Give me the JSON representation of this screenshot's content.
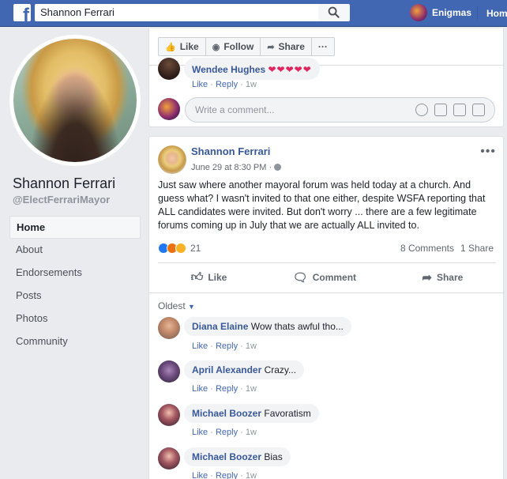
{
  "topbar": {
    "search_value": "Shannon Ferrari",
    "user_name": "Enigmas",
    "home_label": "Hom"
  },
  "profile": {
    "name": "Shannon Ferrari",
    "handle": "@ElectFerrariMayor",
    "nav": [
      "Home",
      "About",
      "Endorsements",
      "Posts",
      "Photos",
      "Community"
    ],
    "active": "Home"
  },
  "action_bar": {
    "like": "Like",
    "follow": "Follow",
    "share": "Share",
    "more": "···"
  },
  "prev_post": {
    "reply_author": "Wendee Hughes",
    "reply_text": "❤❤❤❤❤",
    "reply_like": "Like",
    "reply_reply": "Reply",
    "reply_time": "1w",
    "comment_placeholder": "Write a comment..."
  },
  "post": {
    "author": "Shannon Ferrari",
    "time": "June 29 at 8:30 PM · ",
    "text": "Just saw where another mayoral forum was held today at a church. And guess what? I wasn't invited to that one either, despite WSFA reporting that ALL candidates were invited. But don't worry ... there are a few legitimate forums coming up in July that we are actually ALL invited to.",
    "reactions_count": "21",
    "comments_count": "8 Comments",
    "shares_count": "1 Share",
    "like_label": "Like",
    "comment_label": "Comment",
    "share_label": "Share",
    "sort_label": "Oldest"
  },
  "comments": [
    {
      "author": "Diana Elaine",
      "text": "Wow thats awful tho...",
      "like": "Like",
      "reply": "Reply",
      "time": "1w"
    },
    {
      "author": "April Alexander",
      "text": "Crazy...",
      "like": "Like",
      "reply": "Reply",
      "time": "1w"
    },
    {
      "author": "Michael Boozer",
      "text": "Favoratism",
      "like": "Like",
      "reply": "Reply",
      "time": "1w"
    },
    {
      "author": "Michael Boozer",
      "text": "Bias",
      "like": "Like",
      "reply": "Reply",
      "time": "1w"
    }
  ]
}
